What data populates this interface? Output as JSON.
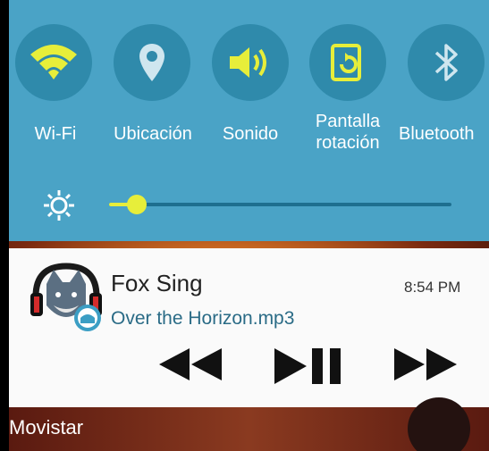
{
  "quick_settings": {
    "tiles": [
      {
        "label": "Wi-Fi",
        "icon": "wifi-icon"
      },
      {
        "label": "Ubicación",
        "icon": "location-icon"
      },
      {
        "label": "Sonido",
        "icon": "volume-icon"
      },
      {
        "label": "Pantalla",
        "label2": "rotación",
        "icon": "screen-rotation-icon"
      },
      {
        "label": "Bluetooth",
        "icon": "bluetooth-icon"
      }
    ],
    "brightness_level": 0.08
  },
  "notification": {
    "app_icon": "fox-avatar-icon",
    "title": "Fox Sing",
    "subtitle": "Over the Horizon.mp3",
    "time": "8:54 PM",
    "controls": [
      "previous-icon",
      "play-pause-icon",
      "next-icon"
    ]
  },
  "status": {
    "carrier": "Movistar"
  },
  "colors": {
    "accent": "#e7ee3a",
    "tile": "#2f8aab",
    "panel": "#4aa3c6"
  }
}
